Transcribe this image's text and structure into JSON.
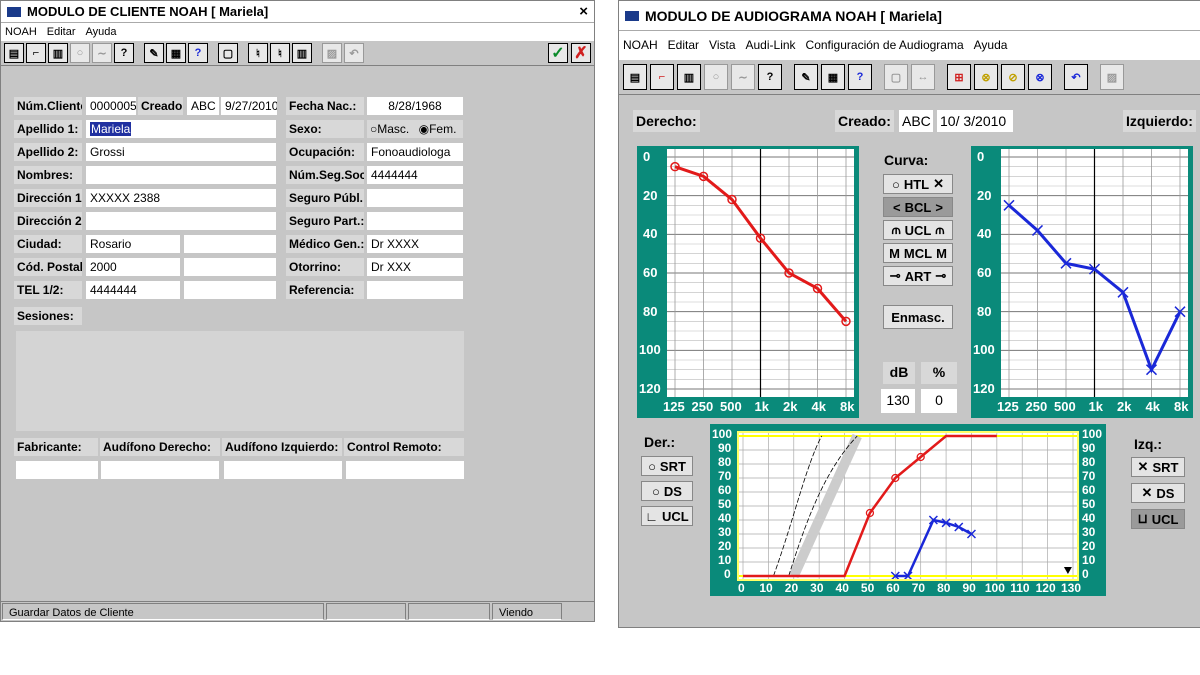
{
  "client": {
    "title": "MODULO DE CLIENTE NOAH [ Mariela]",
    "close": "×",
    "menu": [
      "NOAH",
      "Editar",
      "Ayuda"
    ],
    "labels": {
      "num": "Núm.Cliente:",
      "creado": "Creado:",
      "fnac": "Fecha Nac.:",
      "ap1": "Apellido 1:",
      "sexo": "Sexo:",
      "ap2": "Apellido 2:",
      "ocup": "Ocupación:",
      "nombres": "Nombres:",
      "nss": "Núm.Seg.Soc.:",
      "dir1": "Dirección 1:",
      "segpub": "Seguro Públ.:",
      "dir2": "Dirección 2:",
      "segpart": "Seguro Part.:",
      "ciudad": "Ciudad:",
      "medico": "Médico Gen.:",
      "cp": "Cód. Postal:",
      "otorrino": "Otorrino:",
      "tel": "TEL 1/2:",
      "ref": "Referencia:",
      "sesiones": "Sesiones:",
      "fab": "Fabricante:",
      "audder": "Audífono Derecho:",
      "audizq": "Audífono Izquierdo:",
      "ctrl": "Control Remoto:"
    },
    "values": {
      "num": "0000005",
      "creado_by": "ABC",
      "creado_date": "9/27/2010",
      "fnac": "8/28/1968",
      "ap1": "Mariela",
      "sexo_m": "Masc.",
      "sexo_f": "Fem.",
      "ap2": "Grossi",
      "ocup": "Fonoaudiologa",
      "nss": "4444444",
      "dir1": "XXXXX 2388",
      "ciudad": "Rosario",
      "medico": "Dr XXXX",
      "cp": "2000",
      "otorrino": "Dr XXX",
      "tel": "4444444"
    },
    "status": [
      "Guardar Datos de Cliente",
      "",
      "",
      "Viendo"
    ],
    "ok_icon": "check-icon",
    "cancel_icon": "x-icon"
  },
  "audio": {
    "title": "MODULO DE AUDIOGRAMA NOAH [ Mariela]",
    "menu": [
      "NOAH",
      "Editar",
      "Vista",
      "Audi-Link",
      "Configuración de Audiograma",
      "Ayuda"
    ],
    "derecho": "Derecho:",
    "izquierdo": "Izquierdo:",
    "creado": "Creado:",
    "creado_by": "ABC",
    "creado_date": "10/ 3/2010",
    "curva": "Curva:",
    "curves": [
      "HTL",
      "BCL",
      "UCL",
      "MCL",
      "ART"
    ],
    "selected_curve": "BCL",
    "enmasc": "Enmasc.",
    "db_label": "dB",
    "pct_label": "%",
    "db_value": "130",
    "pct_value": "0",
    "der": "Der.:",
    "izq": "Izq.:",
    "der_buttons": [
      "SRT",
      "DS",
      "UCL"
    ],
    "izq_buttons": [
      "SRT",
      "DS",
      "UCL"
    ],
    "izq_selected": "UCL",
    "colors": {
      "right": "#e21a1a",
      "left": "#1a28d8",
      "chart_frame": "#0a8a7a",
      "speech_frame": "#ffff66"
    }
  },
  "chart_data": [
    {
      "type": "line",
      "title": "Derecho",
      "x": [
        "125",
        "250",
        "500",
        "1k",
        "2k",
        "4k",
        "8k"
      ],
      "ylim": [
        120,
        0
      ],
      "yticks": [
        "0",
        "20",
        "40",
        "60",
        "80",
        "100",
        "120"
      ],
      "series": [
        {
          "values": [
            5,
            10,
            22,
            42,
            60,
            68,
            85
          ]
        }
      ]
    },
    {
      "type": "line",
      "title": "Izquierdo",
      "x": [
        "125",
        "250",
        "500",
        "1k",
        "2k",
        "4k",
        "8k"
      ],
      "ylim": [
        120,
        0
      ],
      "yticks": [
        "0",
        "20",
        "40",
        "60",
        "80",
        "100",
        "120"
      ],
      "series": [
        {
          "values": [
            25,
            38,
            55,
            58,
            70,
            110,
            80
          ]
        }
      ]
    },
    {
      "type": "line",
      "x": [
        "0",
        "10",
        "20",
        "30",
        "40",
        "50",
        "60",
        "70",
        "80",
        "90",
        "100",
        "110",
        "120",
        "130"
      ],
      "ylim": [
        0,
        100
      ],
      "yticks_left": [
        "0",
        "10",
        "20",
        "30",
        "40",
        "50",
        "60",
        "70",
        "80",
        "90",
        "100"
      ],
      "yticks_right": [
        "100",
        "90",
        "80",
        "70",
        "60",
        "50",
        "40",
        "30",
        "20",
        "10",
        "0"
      ],
      "series": [
        {
          "x": [
            0,
            10,
            20,
            30,
            40,
            50,
            60,
            70,
            80,
            90,
            100
          ],
          "values": [
            0,
            0,
            0,
            0,
            0,
            45,
            70,
            85,
            100,
            100,
            100
          ]
        },
        {
          "x": [
            60,
            65,
            75,
            80,
            85,
            90
          ],
          "values": [
            0,
            0,
            40,
            38,
            35,
            30
          ]
        }
      ]
    }
  ]
}
